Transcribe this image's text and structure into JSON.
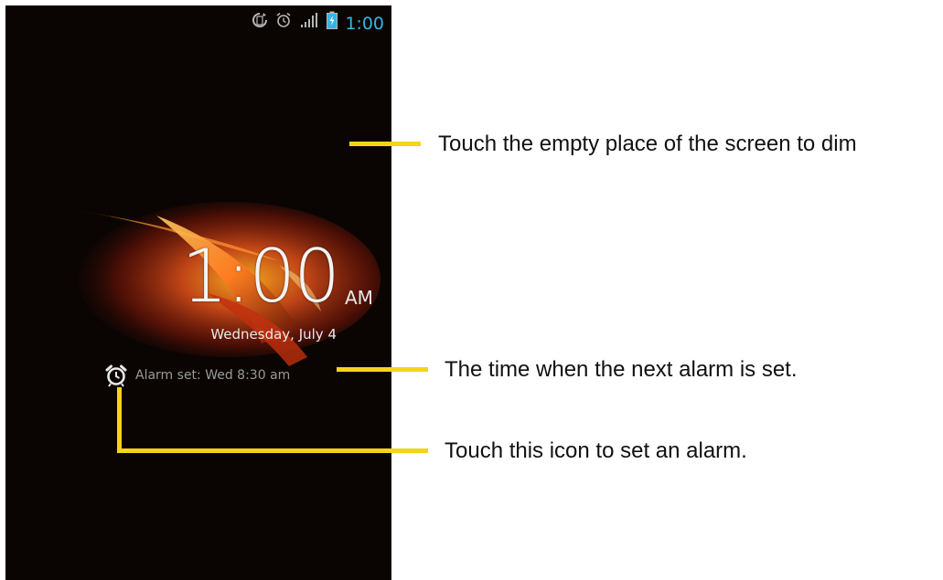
{
  "status_bar": {
    "time": "1:00",
    "icons": [
      "rotate-icon",
      "alarm-clock-icon",
      "signal-bars-icon",
      "battery-charging-icon"
    ]
  },
  "lock_screen": {
    "time": "1:00",
    "ampm": "AM",
    "date": "Wednesday, July 4",
    "alarm_text": "Alarm set: Wed 8:30 am"
  },
  "callouts": {
    "dim": "Touch the empty place of the screen to dim",
    "next_alarm": "The time when the next alarm is set.",
    "set_alarm": "Touch this icon to set an alarm."
  },
  "colors": {
    "callout_line": "#f7d417",
    "status_time": "#33b5e5",
    "screen_background": "#0a0503"
  }
}
